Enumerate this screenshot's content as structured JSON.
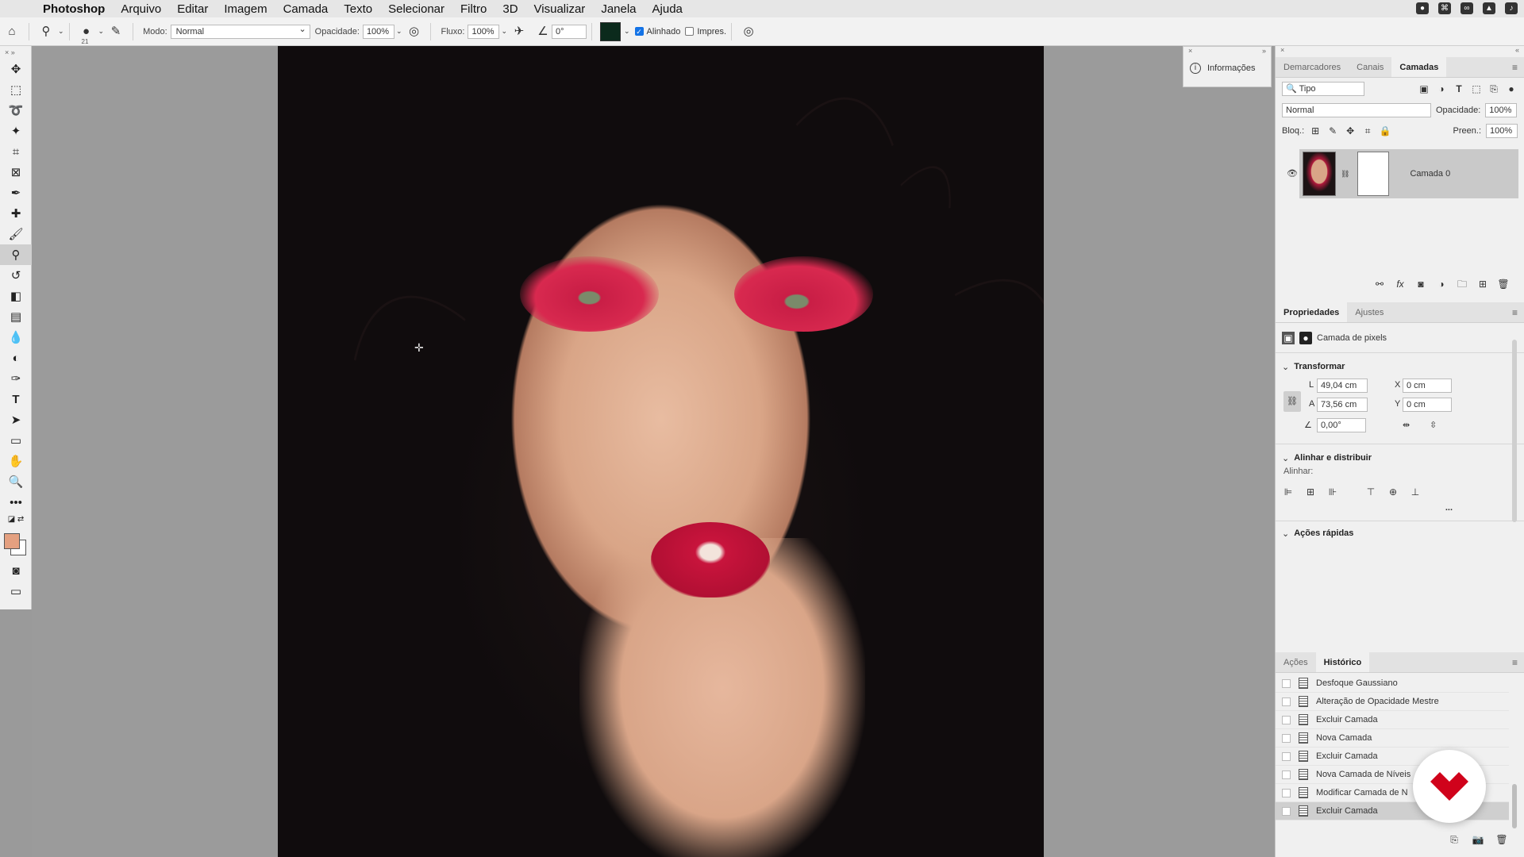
{
  "menubar": {
    "app": "Photoshop",
    "items": [
      "Arquivo",
      "Editar",
      "Imagem",
      "Camada",
      "Texto",
      "Selecionar",
      "Filtro",
      "3D",
      "Visualizar",
      "Janela",
      "Ajuda"
    ]
  },
  "options": {
    "brush_size": "21",
    "mode_label": "Modo:",
    "mode_value": "Normal",
    "opacity_label": "Opacidade:",
    "opacity_value": "100%",
    "flow_label": "Fluxo:",
    "flow_value": "100%",
    "angle_value": "0°",
    "aligned_label": "Alinhado",
    "aligned_checked": true,
    "impres_label": "Impres.",
    "impres_checked": false
  },
  "toolbar": {
    "fg_color": "#e4a080",
    "bg_color": "#ffffff",
    "active_tool": "clone-stamp"
  },
  "info_panel": {
    "label": "Informações"
  },
  "layers_panel": {
    "tabs": [
      "Demarcadores",
      "Canais",
      "Camadas"
    ],
    "active_tab": "Camadas",
    "filter_value": "Tipo",
    "blend_mode": "Normal",
    "opacity_label": "Opacidade:",
    "opacity_value": "100%",
    "lock_label": "Bloq.:",
    "fill_label": "Preen.:",
    "fill_value": "100%",
    "layers": [
      {
        "name": "Camada 0",
        "visible": true
      }
    ]
  },
  "properties_panel": {
    "tabs": [
      "Propriedades",
      "Ajustes"
    ],
    "active_tab": "Propriedades",
    "layer_type": "Camada de pixels",
    "transform_title": "Transformar",
    "w_label": "L",
    "w_value": "49,04 cm",
    "h_label": "A",
    "h_value": "73,56 cm",
    "x_label": "X",
    "x_value": "0 cm",
    "y_label": "Y",
    "y_value": "0 cm",
    "angle_value": "0,00°",
    "align_title": "Alinhar e distribuir",
    "align_sub": "Alinhar:",
    "quick_title": "Ações rápidas",
    "more": "..."
  },
  "history_panel": {
    "tabs": [
      "Ações",
      "Histórico"
    ],
    "active_tab": "Histórico",
    "items": [
      "Desfoque Gaussiano",
      "Alteração de Opacidade Mestre",
      "Excluir Camada",
      "Nova Camada",
      "Excluir Camada",
      "Nova Camada de Níveis",
      "Modificar Camada de N",
      "Excluir Camada"
    ],
    "selected_index": 7
  },
  "colors": {
    "accent": "#1473e6",
    "logo": "#d0021b"
  }
}
